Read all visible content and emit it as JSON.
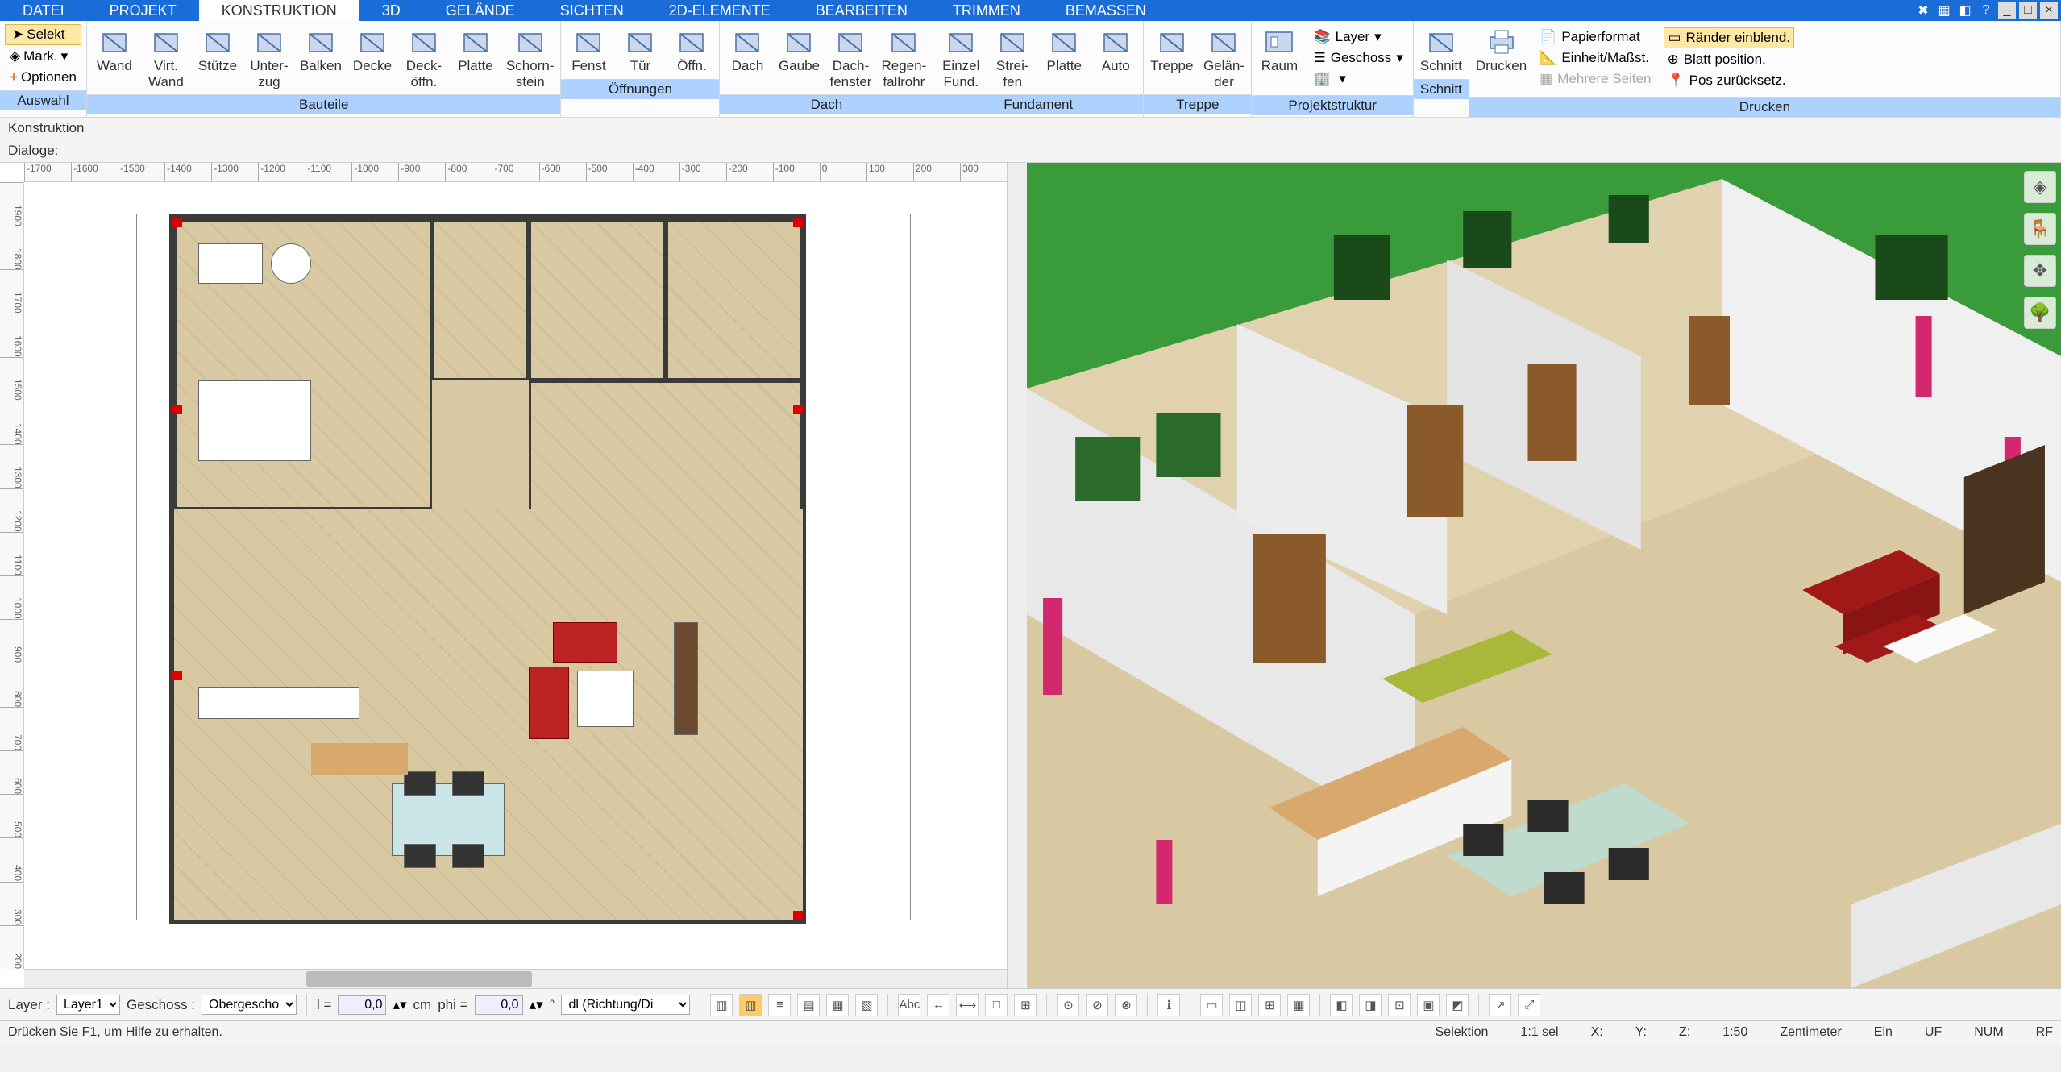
{
  "menu": {
    "tabs": [
      "DATEI",
      "PROJEKT",
      "KONSTRUKTION",
      "3D",
      "GELÄNDE",
      "SICHTEN",
      "2D-ELEMENTE",
      "BEARBEITEN",
      "TRIMMEN",
      "BEMASSEN"
    ],
    "active": "KONSTRUKTION"
  },
  "selection": {
    "selekt": "Selekt",
    "mark": "Mark.",
    "optionen": "Optionen",
    "title": "Auswahl"
  },
  "ribbon": {
    "groups": [
      {
        "title": "Bauteile",
        "items": [
          {
            "k": "wand",
            "label": "Wand"
          },
          {
            "k": "virtwand",
            "label": "Virt.\nWand"
          },
          {
            "k": "stuetze",
            "label": "Stütze"
          },
          {
            "k": "unterzug",
            "label": "Unter-\nzug"
          },
          {
            "k": "balken",
            "label": "Balken"
          },
          {
            "k": "decke",
            "label": "Decke"
          },
          {
            "k": "deckoeffn",
            "label": "Deck-\nöffn."
          },
          {
            "k": "platte",
            "label": "Platte"
          },
          {
            "k": "schornstein",
            "label": "Schorn-\nstein"
          }
        ]
      },
      {
        "title": "Öffnungen",
        "items": [
          {
            "k": "fenst",
            "label": "Fenst"
          },
          {
            "k": "tuer",
            "label": "Tür"
          },
          {
            "k": "oeffn",
            "label": "Öffn."
          }
        ]
      },
      {
        "title": "Dach",
        "items": [
          {
            "k": "dach",
            "label": "Dach"
          },
          {
            "k": "gaube",
            "label": "Gaube"
          },
          {
            "k": "dachfenster",
            "label": "Dach-\nfenster"
          },
          {
            "k": "regenfallrohr",
            "label": "Regen-\nfallrohr"
          }
        ]
      },
      {
        "title": "Fundament",
        "items": [
          {
            "k": "einzelfund",
            "label": "Einzel\nFund."
          },
          {
            "k": "streifen",
            "label": "Strei-\nfen"
          },
          {
            "k": "platte2",
            "label": "Platte"
          },
          {
            "k": "auto",
            "label": "Auto"
          }
        ]
      },
      {
        "title": "Treppe",
        "items": [
          {
            "k": "treppe",
            "label": "Treppe"
          },
          {
            "k": "gelaender",
            "label": "Gelän-\nder"
          }
        ]
      },
      {
        "title": "Projektstruktur",
        "items": [
          {
            "k": "raum",
            "label": "Raum"
          }
        ]
      },
      {
        "title": "Schnitt",
        "items": [
          {
            "k": "schnitt",
            "label": "Schnitt"
          }
        ]
      },
      {
        "title": "Drucken",
        "items": [
          {
            "k": "drucken",
            "label": "Drucken"
          }
        ]
      }
    ],
    "struct_opts": {
      "layer": "Layer",
      "geschoss": "Geschoss"
    },
    "print_opts": {
      "papierformat": "Papierformat",
      "einheit": "Einheit/Maßst.",
      "mehrere": "Mehrere Seiten",
      "raender": "Ränder einblend.",
      "blatt": "Blatt position.",
      "pos": "Pos zurücksetz."
    }
  },
  "subbar1": "Konstruktion",
  "subbar2": "Dialoge:",
  "ruler_h": [
    "-1700",
    "-1600",
    "-1500",
    "-1400",
    "-1300",
    "-1200",
    "-1100",
    "-1000",
    "-900",
    "-800",
    "-700",
    "-600",
    "-500",
    "-400",
    "-300",
    "-200",
    "-100",
    "0",
    "100",
    "200",
    "300"
  ],
  "ruler_v": [
    "1900",
    "1800",
    "1700",
    "1600",
    "1500",
    "1400",
    "1300",
    "1200",
    "1100",
    "1000",
    "900",
    "800",
    "700",
    "600",
    "500",
    "400",
    "300",
    "200"
  ],
  "bottom": {
    "layer_lbl": "Layer :",
    "layer_val": "Layer1",
    "geschoss_lbl": "Geschoss :",
    "geschoss_val": "Obergescho",
    "l_lbl": "l =",
    "l_val": "0,0",
    "l_unit": "cm",
    "phi_lbl": "phi =",
    "phi_val": "0,0",
    "phi_unit": "°",
    "richtung": "dl (Richtung/Di"
  },
  "status": {
    "help": "Drücken Sie F1, um Hilfe zu erhalten.",
    "selektion": "Selektion",
    "sel": "1:1 sel",
    "x": "X:",
    "y": "Y:",
    "z": "Z:",
    "scale": "1:50",
    "unit": "Zentimeter",
    "ein": "Ein",
    "uf": "UF",
    "num": "NUM",
    "rf": "RF"
  }
}
